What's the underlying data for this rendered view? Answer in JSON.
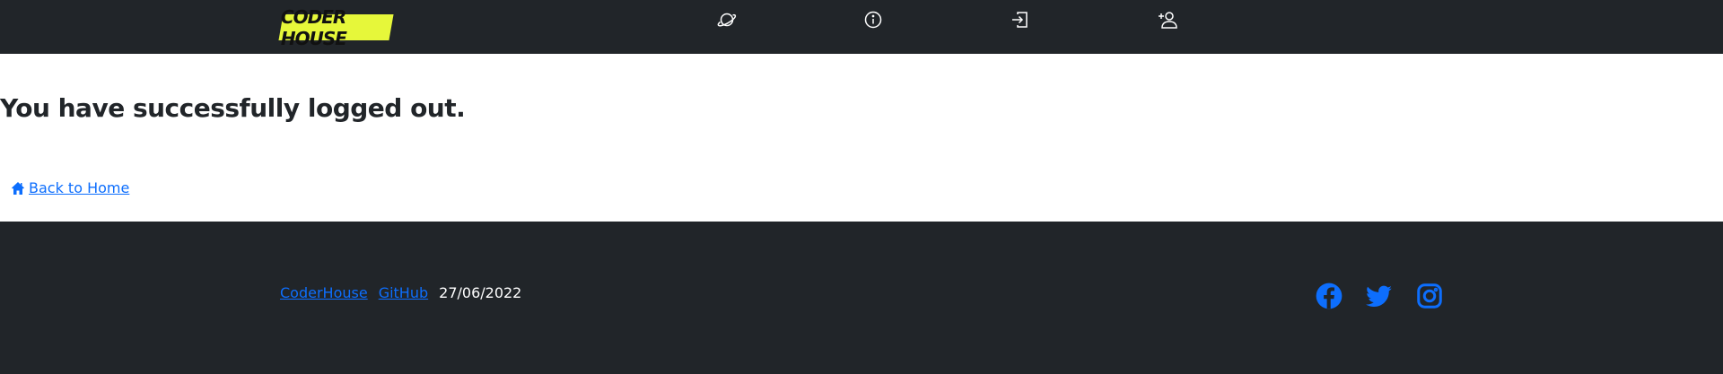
{
  "navbar": {
    "logo_text": "CODER HOUSE",
    "logo_color": "#e6f73a",
    "background": "#212529",
    "icons": [
      "planet-icon",
      "info-icon",
      "login-icon",
      "person-add-icon"
    ]
  },
  "main": {
    "title": "You have successfully logged out.",
    "back_link": {
      "icon": "house-icon",
      "label": " Back to Home"
    }
  },
  "footer": {
    "links": [
      "CoderHouse",
      "GitHub"
    ],
    "date": "27/06/2022",
    "social_icons": [
      "facebook-icon",
      "twitter-icon",
      "instagram-icon"
    ],
    "link_color": "#0d6efd"
  }
}
